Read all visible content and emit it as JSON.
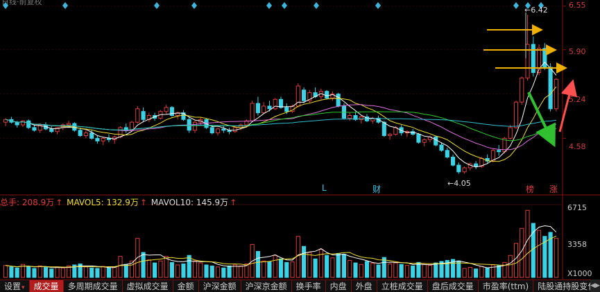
{
  "chart_title_fragment": "日线·前复权",
  "price_axis": {
    "ticks": [
      "6.55",
      "5.90",
      "5.24",
      "4.58"
    ]
  },
  "volume_axis": {
    "ticks": [
      "6715",
      "3358",
      "X1000"
    ]
  },
  "annotations": {
    "high_label": "6.42",
    "low_label": "4.05",
    "markers": [
      {
        "text": "L",
        "color": "#3cc8e6"
      },
      {
        "text": "财",
        "color": "#3cc8e6"
      },
      {
        "text": "榜",
        "color": "#e23c3c"
      },
      {
        "text": "涨",
        "color": "#e23c3c"
      }
    ]
  },
  "volume_legend": {
    "total_label": "总手: 208.9万",
    "mavol5_label": "MAVOL5: 132.9万",
    "mavol10_label": "MAVOL10: 145.9万"
  },
  "tabs": [
    {
      "label": "设置",
      "has_arrow": true,
      "active": false
    },
    {
      "label": "成交量",
      "has_arrow": false,
      "active": true
    },
    {
      "label": "多周期成交量",
      "has_arrow": false,
      "active": false
    },
    {
      "label": "虚拟成交量",
      "has_arrow": false,
      "active": false
    },
    {
      "label": "金额",
      "has_arrow": false,
      "active": false
    },
    {
      "label": "沪深金额",
      "has_arrow": false,
      "active": false
    },
    {
      "label": "沪深京金额",
      "has_arrow": false,
      "active": false
    },
    {
      "label": "换手率",
      "has_arrow": false,
      "active": false
    },
    {
      "label": "内盘",
      "has_arrow": false,
      "active": false
    },
    {
      "label": "外盘",
      "has_arrow": false,
      "active": false
    },
    {
      "label": "立桩成交量",
      "has_arrow": false,
      "active": false
    },
    {
      "label": "盘后成交量",
      "has_arrow": false,
      "active": false
    },
    {
      "label": "市盈率(ttm)",
      "has_arrow": false,
      "active": false
    },
    {
      "label": "陆股通持股变化",
      "has_arrow": true,
      "active": false
    }
  ],
  "colors": {
    "up": "#e23c3c",
    "down": "#3cd2e6",
    "ma5": "#ffffff",
    "ma10": "#f0e030",
    "ma20": "#e070e0",
    "ma30": "#30d030",
    "ma60": "#30c0d0",
    "annotation_arrow_yellow": "#f0b000",
    "annotation_arrow_green": "#30c030",
    "annotation_arrow_red": "#ff5050"
  },
  "chart_data": {
    "type": "candlestick",
    "price_ylim": [
      3.85,
      6.6
    ],
    "volume_ylim": [
      0,
      7200
    ],
    "volume_unit": "X1000",
    "candles": [
      [
        4.82,
        4.88,
        4.76,
        4.86
      ],
      [
        4.86,
        4.9,
        4.8,
        4.82
      ],
      [
        4.82,
        4.84,
        4.74,
        4.78
      ],
      [
        4.78,
        4.85,
        4.75,
        4.84
      ],
      [
        4.84,
        4.86,
        4.72,
        4.74
      ],
      [
        4.74,
        4.78,
        4.68,
        4.7
      ],
      [
        4.7,
        4.8,
        4.66,
        4.78
      ],
      [
        4.78,
        4.82,
        4.7,
        4.72
      ],
      [
        4.72,
        4.76,
        4.66,
        4.68
      ],
      [
        4.68,
        4.75,
        4.64,
        4.74
      ],
      [
        4.74,
        4.8,
        4.7,
        4.78
      ],
      [
        4.78,
        4.84,
        4.74,
        4.8
      ],
      [
        4.8,
        4.82,
        4.68,
        4.7
      ],
      [
        4.7,
        4.74,
        4.6,
        4.62
      ],
      [
        4.62,
        4.7,
        4.58,
        4.66
      ],
      [
        4.66,
        4.7,
        4.56,
        4.58
      ],
      [
        4.58,
        4.62,
        4.5,
        4.54
      ],
      [
        4.54,
        4.6,
        4.48,
        4.58
      ],
      [
        4.58,
        4.64,
        4.52,
        4.56
      ],
      [
        4.56,
        4.62,
        4.5,
        4.6
      ],
      [
        4.6,
        4.76,
        4.58,
        4.74
      ],
      [
        4.74,
        4.8,
        4.66,
        4.7
      ],
      [
        4.7,
        4.84,
        4.68,
        4.82
      ],
      [
        4.82,
        5.06,
        4.8,
        5.02
      ],
      [
        4.98,
        5.04,
        4.82,
        4.86
      ],
      [
        4.86,
        4.96,
        4.82,
        4.92
      ],
      [
        4.92,
        4.96,
        4.84,
        4.88
      ],
      [
        4.88,
        5.0,
        4.86,
        4.98
      ],
      [
        4.98,
        5.08,
        4.94,
        5.04
      ],
      [
        5.04,
        5.06,
        4.9,
        4.92
      ],
      [
        4.92,
        4.98,
        4.86,
        4.96
      ],
      [
        4.96,
        5.0,
        4.84,
        4.86
      ],
      [
        4.86,
        4.9,
        4.66,
        4.7
      ],
      [
        4.7,
        4.84,
        4.66,
        4.82
      ],
      [
        4.82,
        4.9,
        4.78,
        4.86
      ],
      [
        4.86,
        4.88,
        4.72,
        4.74
      ],
      [
        4.74,
        4.78,
        4.64,
        4.66
      ],
      [
        4.66,
        4.74,
        4.62,
        4.72
      ],
      [
        4.72,
        4.76,
        4.66,
        4.7
      ],
      [
        4.7,
        4.74,
        4.64,
        4.68
      ],
      [
        4.68,
        4.76,
        4.66,
        4.74
      ],
      [
        4.74,
        4.8,
        4.7,
        4.78
      ],
      [
        4.78,
        4.86,
        4.74,
        4.84
      ],
      [
        4.84,
        5.14,
        4.82,
        5.1
      ],
      [
        5.1,
        5.2,
        4.92,
        4.96
      ],
      [
        4.96,
        5.12,
        4.94,
        5.06
      ],
      [
        5.06,
        5.14,
        4.98,
        5.02
      ],
      [
        5.02,
        5.18,
        5.0,
        5.16
      ],
      [
        5.16,
        5.2,
        5.02,
        5.04
      ],
      [
        5.04,
        5.1,
        4.94,
        4.98
      ],
      [
        4.98,
        5.08,
        4.96,
        5.06
      ],
      [
        5.06,
        5.4,
        5.04,
        5.36
      ],
      [
        5.3,
        5.34,
        5.1,
        5.14
      ],
      [
        5.14,
        5.3,
        5.1,
        5.26
      ],
      [
        5.26,
        5.34,
        5.18,
        5.2
      ],
      [
        5.2,
        5.32,
        5.16,
        5.28
      ],
      [
        5.28,
        5.3,
        5.16,
        5.18
      ],
      [
        5.18,
        5.28,
        5.14,
        5.24
      ],
      [
        5.24,
        5.26,
        5.04,
        5.06
      ],
      [
        5.06,
        5.1,
        4.86,
        4.88
      ],
      [
        4.88,
        4.96,
        4.84,
        4.92
      ],
      [
        4.92,
        4.98,
        4.84,
        4.86
      ],
      [
        4.86,
        4.92,
        4.8,
        4.9
      ],
      [
        4.9,
        4.94,
        4.82,
        4.84
      ],
      [
        4.84,
        4.9,
        4.8,
        4.88
      ],
      [
        4.88,
        4.92,
        4.8,
        4.82
      ],
      [
        4.82,
        4.84,
        4.6,
        4.62
      ],
      [
        4.62,
        4.66,
        4.56,
        4.64
      ],
      [
        4.64,
        4.76,
        4.62,
        4.74
      ],
      [
        4.74,
        4.78,
        4.62,
        4.66
      ],
      [
        4.66,
        4.7,
        4.6,
        4.68
      ],
      [
        4.68,
        4.72,
        4.62,
        4.64
      ],
      [
        4.64,
        4.66,
        4.5,
        4.52
      ],
      [
        4.52,
        4.58,
        4.46,
        4.56
      ],
      [
        4.56,
        4.62,
        4.52,
        4.6
      ],
      [
        4.6,
        4.62,
        4.46,
        4.48
      ],
      [
        4.48,
        4.52,
        4.38,
        4.4
      ],
      [
        4.4,
        4.44,
        4.28,
        4.3
      ],
      [
        4.3,
        4.34,
        4.16,
        4.18
      ],
      [
        4.18,
        4.22,
        4.05,
        4.08
      ],
      [
        4.08,
        4.16,
        4.05,
        4.14
      ],
      [
        4.14,
        4.22,
        4.1,
        4.2
      ],
      [
        4.2,
        4.24,
        4.12,
        4.16
      ],
      [
        4.16,
        4.3,
        4.14,
        4.28
      ],
      [
        4.28,
        4.34,
        4.2,
        4.24
      ],
      [
        4.24,
        4.42,
        4.22,
        4.4
      ],
      [
        4.4,
        4.48,
        4.32,
        4.38
      ],
      [
        4.38,
        4.6,
        4.36,
        4.58
      ],
      [
        4.58,
        4.78,
        4.56,
        4.74
      ],
      [
        4.74,
        5.14,
        4.72,
        5.12
      ],
      [
        5.12,
        5.5,
        5.08,
        5.48
      ],
      [
        5.48,
        6.42,
        5.44,
        5.98
      ],
      [
        5.98,
        6.1,
        5.5,
        5.56
      ],
      [
        5.56,
        5.98,
        5.52,
        5.92
      ],
      [
        5.92,
        6.0,
        5.6,
        5.64
      ],
      [
        5.64,
        5.7,
        4.98,
        5.02
      ],
      [
        5.02,
        5.48,
        4.98,
        5.46
      ]
    ],
    "volumes": [
      1200,
      1050,
      950,
      1300,
      1100,
      900,
      1150,
      1000,
      850,
      1050,
      950,
      1150,
      1250,
      1350,
      1050,
      950,
      900,
      1100,
      950,
      1050,
      2100,
      1300,
      1650,
      3900,
      2500,
      1750,
      1450,
      1650,
      2100,
      1500,
      1250,
      1350,
      2200,
      1650,
      1450,
      1250,
      1150,
      1050,
      950,
      1150,
      1250,
      1150,
      1350,
      3300,
      2600,
      1650,
      1550,
      2200,
      1850,
      1500,
      1550,
      4100,
      3100,
      2500,
      1850,
      2800,
      2200,
      1950,
      2400,
      2300,
      1700,
      1450,
      1300,
      1600,
      1400,
      1250,
      2000,
      1350,
      1450,
      1300,
      1200,
      1150,
      1500,
      1300,
      1200,
      1450,
      1600,
      1700,
      1800,
      1650,
      900,
      1000,
      850,
      1100,
      950,
      1250,
      1200,
      1500,
      2200,
      3400,
      4900,
      6700,
      5400,
      4700,
      4100,
      4500,
      3900
    ]
  }
}
